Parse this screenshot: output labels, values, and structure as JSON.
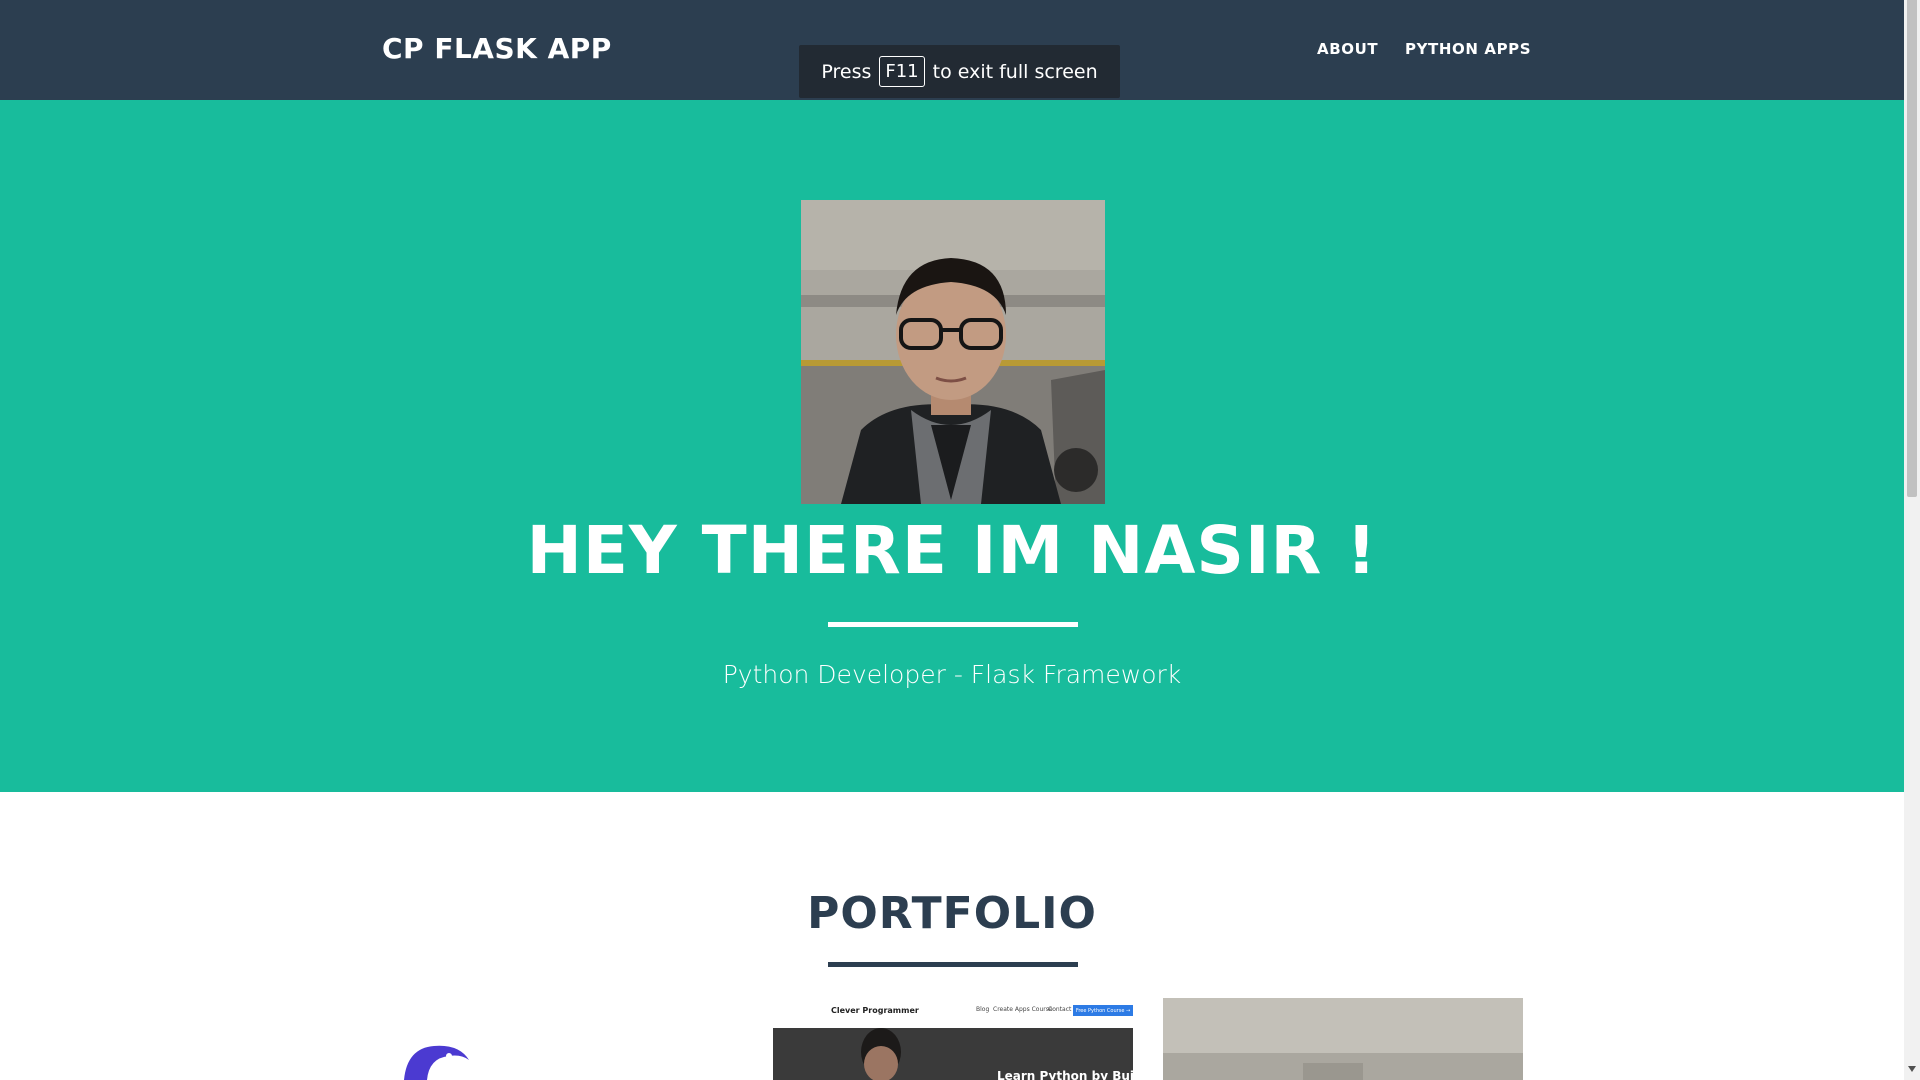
{
  "navbar": {
    "brand": "CP FLASK APP",
    "links": [
      {
        "label": "ABOUT"
      },
      {
        "label": "PYTHON APPS"
      }
    ]
  },
  "fullscreen_toast": {
    "prefix": "Press",
    "key": "F11",
    "suffix": "to exit full screen"
  },
  "hero": {
    "title": "HEY THERE IM NASIR !",
    "subtitle": "Python Developer - Flask Framework",
    "colors": {
      "background": "#18bc9c",
      "text": "#ffffff"
    }
  },
  "portfolio": {
    "title": "PORTFOLIO",
    "items": [
      {
        "icon": "python-logo-icon"
      },
      {
        "brand": "Clever Programmer",
        "menu": [
          "Blog",
          "Create Apps Course",
          "Contact"
        ],
        "cta": "Free Python Course →",
        "hero_text": "Learn Python by Buildi"
      },
      {
        "icon": "photo-thumbnail"
      }
    ]
  },
  "theme": {
    "navbar_bg": "#2c3e50",
    "accent": "#18bc9c",
    "portfolio_text": "#2c3e50"
  }
}
